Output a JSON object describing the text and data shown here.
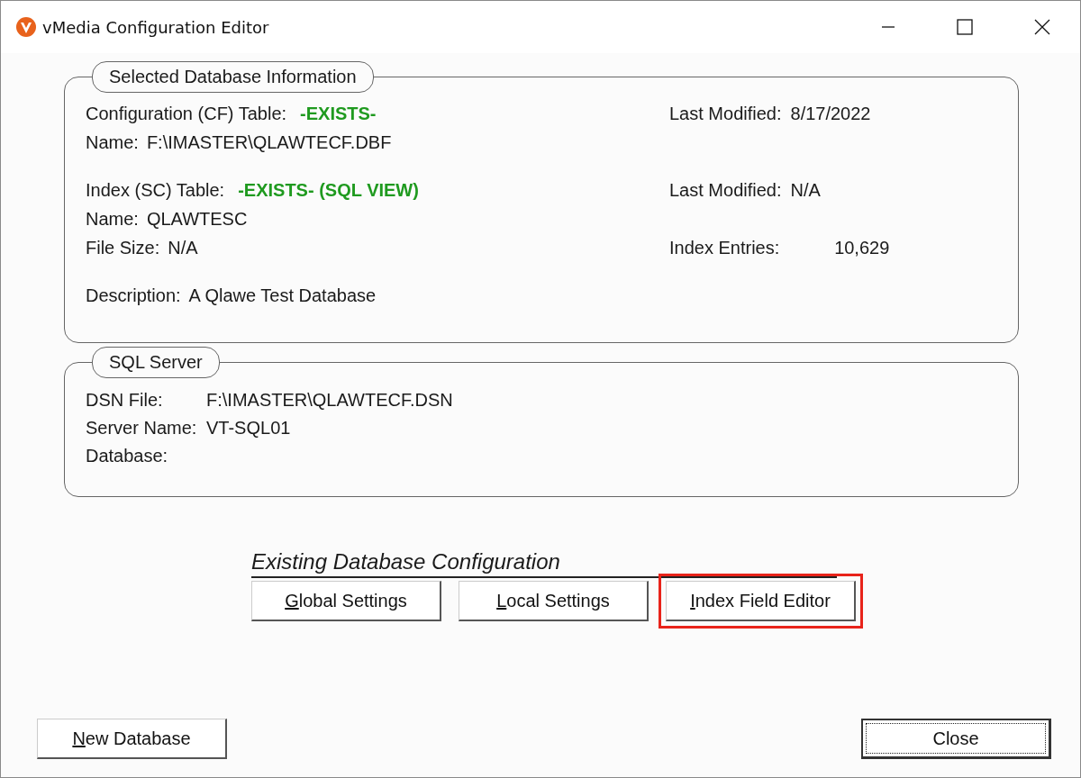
{
  "window": {
    "title": "vMedia Configuration Editor"
  },
  "database_info": {
    "legend": "Selected Database Information",
    "blocks": [
      {
        "rows": [
          {
            "left": {
              "label": "Configuration (CF) Table:",
              "value": "-EXISTS-",
              "kind": "status"
            },
            "right": {
              "label": "Last Modified:",
              "value": "8/17/2022",
              "kind": "plain"
            }
          },
          {
            "left": {
              "label": "Name:",
              "value": "F:\\IMASTER\\QLAWTECF.DBF",
              "kind": "plain"
            }
          }
        ]
      },
      {
        "rows": [
          {
            "left": {
              "label": "Index (SC) Table:",
              "value": "-EXISTS- (SQL VIEW)",
              "kind": "status"
            },
            "right": {
              "label": "Last Modified:",
              "value": "N/A",
              "kind": "plain"
            }
          },
          {
            "left": {
              "label": "Name:",
              "value": "QLAWTESC",
              "kind": "plain"
            }
          },
          {
            "left": {
              "label": "File Size:",
              "value": "N/A",
              "kind": "plain"
            },
            "right": {
              "label": "Index Entries:",
              "value": "10,629",
              "kind": "count"
            }
          }
        ]
      },
      {
        "rows": [
          {
            "left": {
              "label": "Description:",
              "value": "A Qlawe Test Database",
              "kind": "plain"
            }
          }
        ]
      }
    ]
  },
  "sql_server": {
    "legend": "SQL Server",
    "rows": [
      {
        "label": "DSN File:",
        "value": "F:\\IMASTER\\QLAWTECF.DSN"
      },
      {
        "label": "Server Name:",
        "value": "VT-SQL01"
      },
      {
        "label": "Database:"
      }
    ]
  },
  "existing_config": {
    "heading": "Existing Database Configuration",
    "buttons": [
      {
        "label": "Global Settings",
        "access_key_underlined": true,
        "highlighted": false
      },
      {
        "label": "Local Settings",
        "access_key_underlined": true,
        "highlighted": false
      },
      {
        "label": "Index Field Editor",
        "access_key_underlined": true,
        "highlighted": true
      }
    ]
  },
  "footer_buttons": [
    {
      "label": "New Database",
      "access_key_underlined": true,
      "focused": false
    },
    {
      "label": "Close",
      "access_key_underlined": false,
      "focused": true
    }
  ]
}
